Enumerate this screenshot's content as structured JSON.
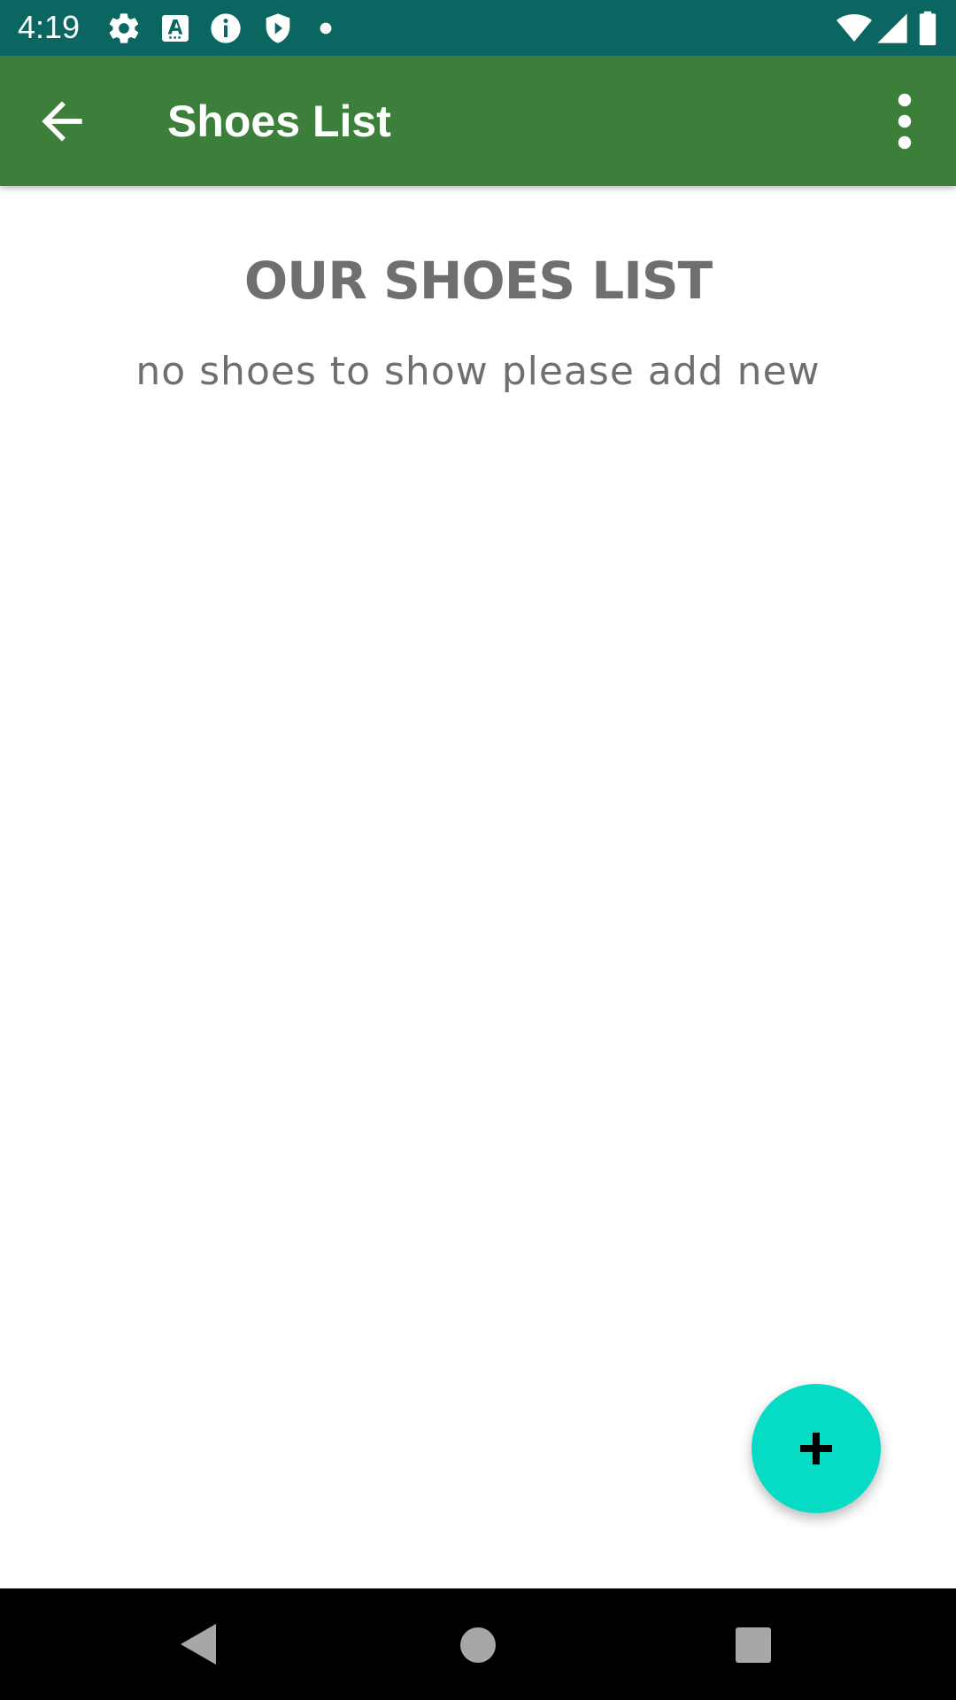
{
  "status_bar": {
    "time": "4:19",
    "left_icons": [
      "settings-gear-icon",
      "font-a-icon",
      "info-icon",
      "play-shield-icon",
      "dot-icon"
    ],
    "right_icons": [
      "wifi-icon",
      "signal-icon",
      "battery-icon"
    ]
  },
  "app_bar": {
    "title": "Shoes List",
    "back_icon": "arrow-back-icon",
    "menu_icon": "more-vert-icon",
    "color": "#3b7f3b"
  },
  "content": {
    "heading": "OUR SHOES LIST",
    "empty_message": "no shoes to show please add new",
    "text_color": "#6f6f6f"
  },
  "fab": {
    "icon": "plus-icon",
    "color": "#06dbc5"
  },
  "navigation_bar": {
    "buttons": [
      "back-triangle-icon",
      "home-circle-icon",
      "recents-square-icon"
    ]
  }
}
